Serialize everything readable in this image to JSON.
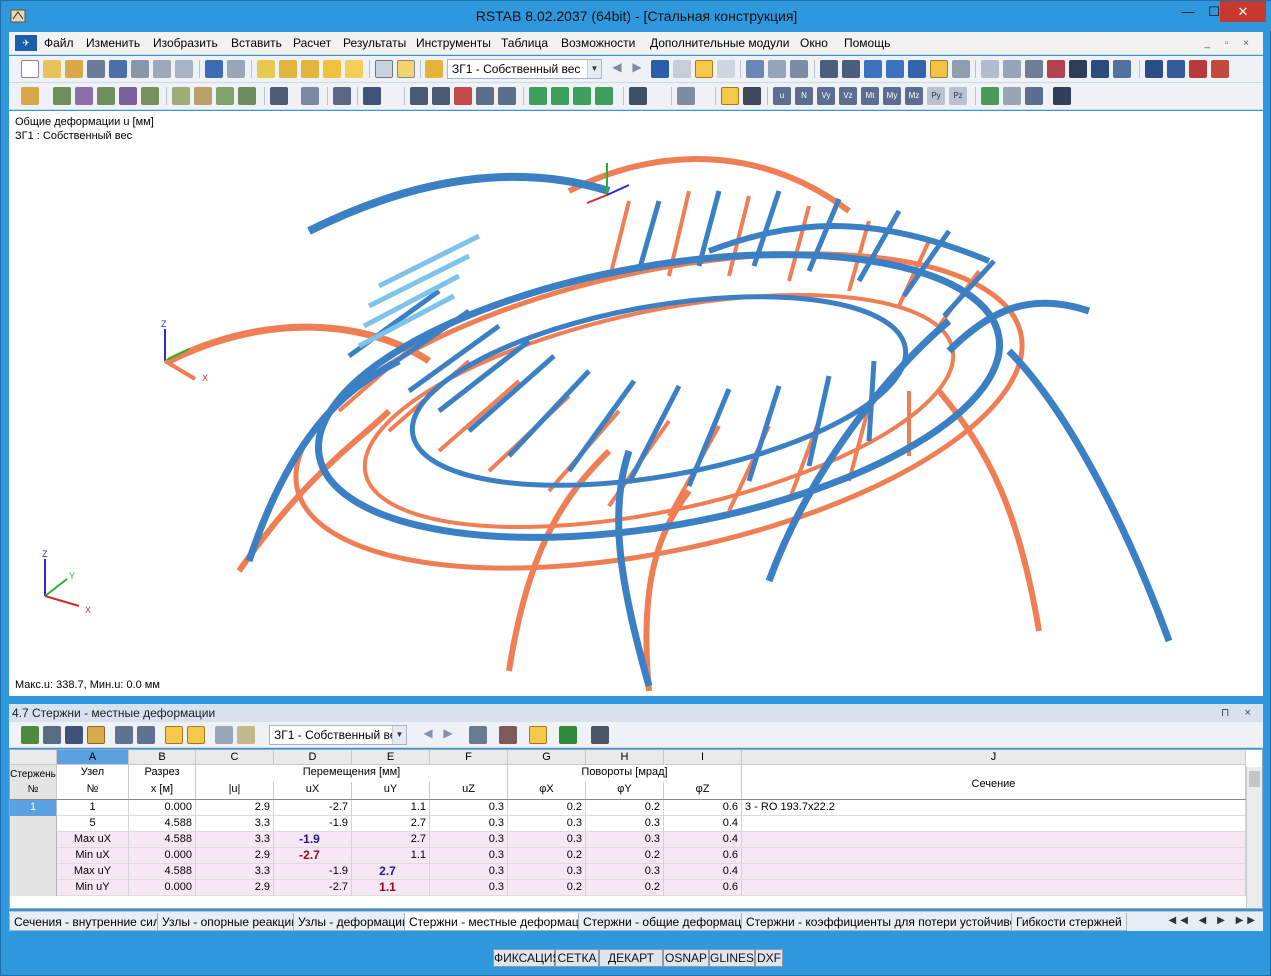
{
  "window": {
    "title": "RSTAB 8.02.2037 (64bit) - [Стальная конструкция]",
    "minimize": "—",
    "maximize": "☐",
    "close": "✕"
  },
  "menu": {
    "items": [
      "Файл",
      "Изменить",
      "Изобразить",
      "Вставить",
      "Расчет",
      "Результаты",
      "Инструменты",
      "Таблица",
      "Возможности",
      "Дополнительные модули",
      "Окно",
      "Помощь"
    ],
    "mdi_controls": "_ ▫ ×"
  },
  "toolbar": {
    "loadcase_combo": "ЗГ1 - Собственный вес"
  },
  "viewport": {
    "result_line1": "Общие деформации u [мм]",
    "result_line2": "ЗГ1 : Собственный вес",
    "footer": "Макс.u: 338.7, Мин.u: 0.0 мм",
    "axis_labels": {
      "x": "X",
      "y": "Y",
      "z": "Z"
    },
    "colors": {
      "deformed": "#3b7fc4",
      "undeformed": "#f07e55",
      "highlight": "#7ec3ea"
    }
  },
  "panel": {
    "title": "4.7 Стержни - местные деформации",
    "pins": "⊓ ×",
    "loadcase_combo": "ЗГ1 - Собственный вес"
  },
  "table": {
    "col_letters": [
      "A",
      "B",
      "C",
      "D",
      "E",
      "F",
      "G",
      "H",
      "I",
      "J"
    ],
    "headers": {
      "row_head": "Стержень №",
      "a_top": "Узел",
      "a_bot": "№",
      "b_top": "Разрез",
      "b_bot": "x [м]",
      "disp_group": "Перемещения [мм]",
      "c": "|u|",
      "d": "uX",
      "e": "uY",
      "f": "uZ",
      "rot_group": "Повороты [мрад]",
      "g": "φX",
      "h": "φY",
      "i": "φZ",
      "j": "Сечение"
    },
    "rows": [
      {
        "rowhead": "1",
        "node": "1",
        "x": "0.000",
        "u": "2.9",
        "ux": "-2.7",
        "uy": "1.1",
        "uz": "0.3",
        "px": "0.2",
        "py": "0.2",
        "pz": "0.6",
        "section": "3 - RO 193.7x22.2"
      },
      {
        "rowhead": "",
        "node": "5",
        "x": "4.588",
        "u": "3.3",
        "ux": "-1.9",
        "uy": "2.7",
        "uz": "0.3",
        "px": "0.3",
        "py": "0.3",
        "pz": "0.4",
        "section": ""
      },
      {
        "rowhead": "",
        "node": "Max uX",
        "x": "4.588",
        "u": "3.3",
        "ux": "-1.9",
        "uy": "2.7",
        "uz": "0.3",
        "px": "0.3",
        "py": "0.3",
        "pz": "0.4",
        "section": ""
      },
      {
        "rowhead": "",
        "node": "Min uX",
        "x": "0.000",
        "u": "2.9",
        "ux": "-2.7",
        "uy": "1.1",
        "uz": "0.3",
        "px": "0.2",
        "py": "0.2",
        "pz": "0.6",
        "section": ""
      },
      {
        "rowhead": "",
        "node": "Max uY",
        "x": "4.588",
        "u": "3.3",
        "ux": "-1.9",
        "uy": "2.7",
        "uz": "0.3",
        "px": "0.3",
        "py": "0.3",
        "pz": "0.4",
        "section": ""
      },
      {
        "rowhead": "",
        "node": "Min uY",
        "x": "0.000",
        "u": "2.9",
        "ux": "-2.7",
        "uy": "1.1",
        "uz": "0.3",
        "px": "0.2",
        "py": "0.2",
        "pz": "0.6",
        "section": ""
      }
    ]
  },
  "tabs": [
    "Сечения - внутренние силы",
    "Узлы - опорные реакции",
    "Узлы - деформации",
    "Стержни - местные деформации",
    "Стержни - общие деформации",
    "Стержни - коэффициенты для потери устойчивости",
    "Гибкости стержней"
  ],
  "tab_nav": "◀◀ ◀ ▶ ▶▶",
  "status": [
    "ФИКСАЦИЯ",
    "СЕТКА",
    "ДЕКАРТ",
    "OSNAP",
    "GLINES",
    "DXF"
  ]
}
